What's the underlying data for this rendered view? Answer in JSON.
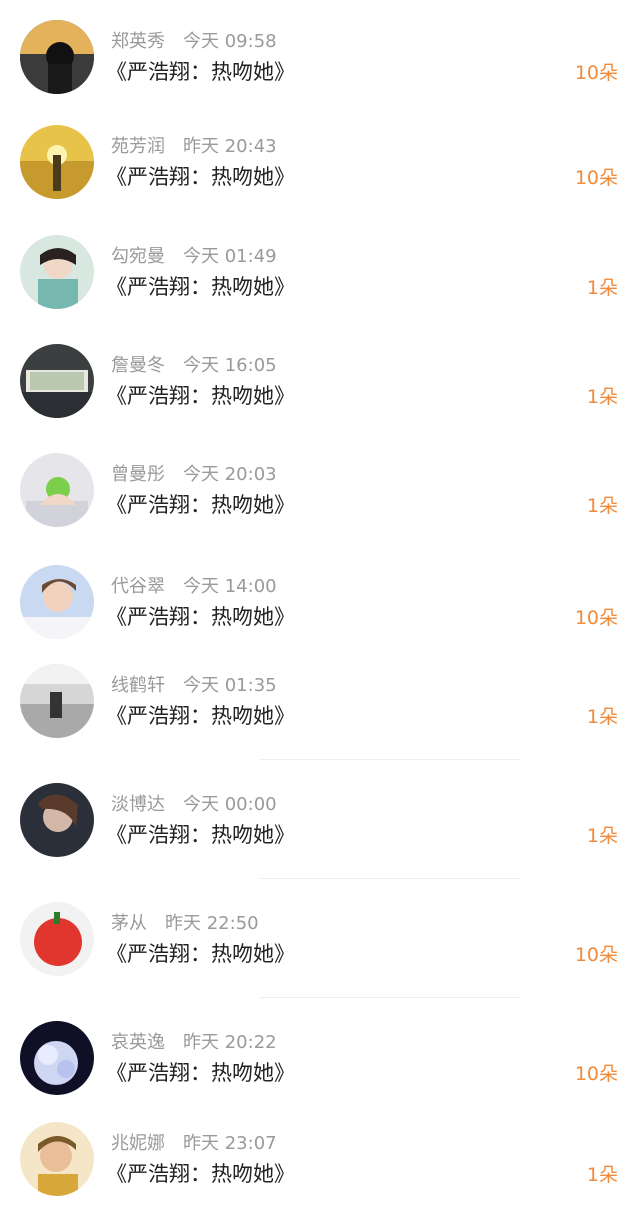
{
  "items": [
    {
      "name": "郑英秀",
      "time": "今天 09:58",
      "title": "《严浩翔：热吻她》",
      "gift": "10朵"
    },
    {
      "name": "苑芳润",
      "time": "昨天 20:43",
      "title": "《严浩翔：热吻她》",
      "gift": "10朵"
    },
    {
      "name": "勾宛曼",
      "time": "今天 01:49",
      "title": "《严浩翔：热吻她》",
      "gift": "1朵"
    },
    {
      "name": "詹曼冬",
      "time": "今天 16:05",
      "title": "《严浩翔：热吻她》",
      "gift": "1朵"
    },
    {
      "name": "曾曼彤",
      "time": "今天 20:03",
      "title": "《严浩翔：热吻她》",
      "gift": "1朵"
    },
    {
      "name": "代谷翠",
      "time": "今天 14:00",
      "title": "《严浩翔：热吻她》",
      "gift": "10朵"
    },
    {
      "name": "线鹤轩",
      "time": "今天 01:35",
      "title": "《严浩翔：热吻她》",
      "gift": "1朵"
    },
    {
      "name": "淡博达",
      "time": "今天 00:00",
      "title": "《严浩翔：热吻她》",
      "gift": "1朵"
    },
    {
      "name": "茅从",
      "time": "昨天 22:50",
      "title": "《严浩翔：热吻她》",
      "gift": "10朵"
    },
    {
      "name": "哀英逸",
      "time": "昨天 20:22",
      "title": "《严浩翔：热吻她》",
      "gift": "10朵"
    },
    {
      "name": "兆妮娜",
      "time": "昨天 23:07",
      "title": "《严浩翔：热吻她》",
      "gift": "1朵"
    }
  ],
  "colors": {
    "accent": "#f08a3c",
    "name": "#9a9a9a",
    "title": "#222222"
  }
}
